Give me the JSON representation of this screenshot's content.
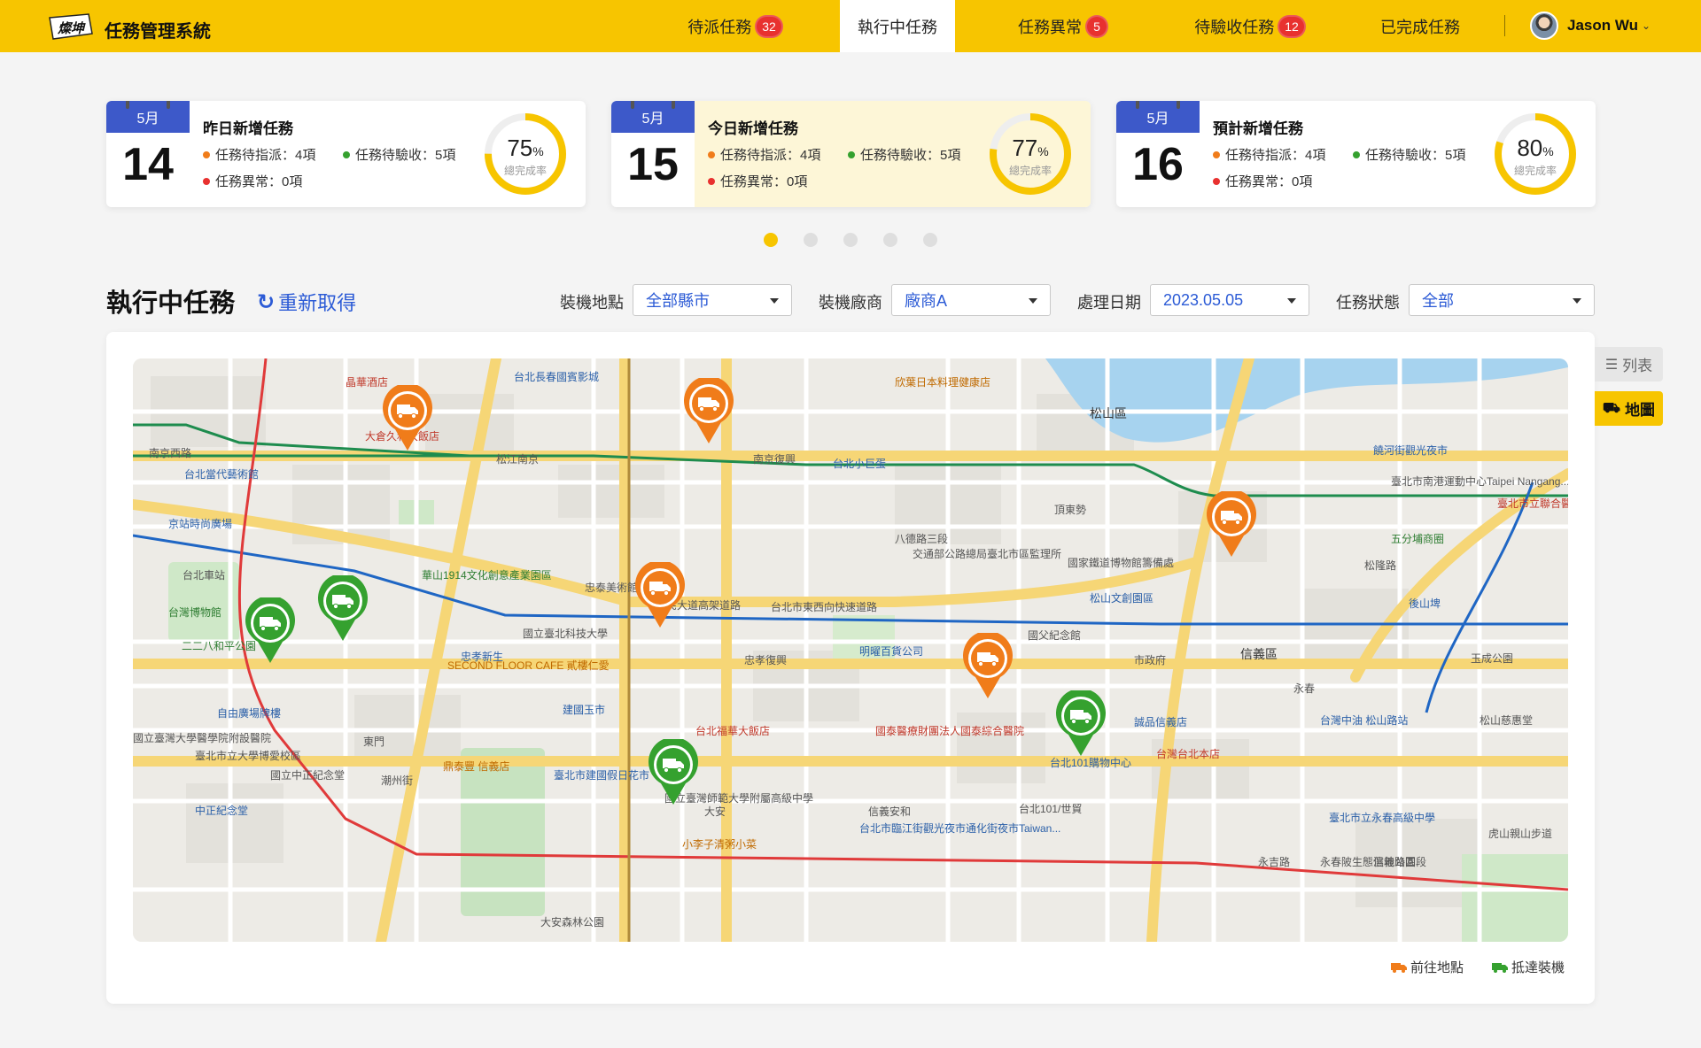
{
  "app": {
    "logo_text": "燦坤",
    "title": "任務管理系統"
  },
  "nav": {
    "items": [
      {
        "label": "待派任務",
        "badge": "32"
      },
      {
        "label": "執行中任務",
        "badge": ""
      },
      {
        "label": "任務異常",
        "badge": "5"
      },
      {
        "label": "待驗收任務",
        "badge": "12"
      },
      {
        "label": "已完成任務",
        "badge": ""
      }
    ],
    "active": "執行中任務"
  },
  "user": {
    "name": "Jason Wu"
  },
  "cards": [
    {
      "month": "5月",
      "day": "14",
      "title": "昨日新增任務",
      "pending_assign": "任務待指派：4項",
      "pending_accept": "任務待驗收：5項",
      "abnormal": "任務異常：0項",
      "rate": 75,
      "rate_text": "75",
      "rate_unit": "%",
      "rate_label": "總完成率",
      "highlight": false
    },
    {
      "month": "5月",
      "day": "15",
      "title": "今日新增任務",
      "pending_assign": "任務待指派：4項",
      "pending_accept": "任務待驗收：5項",
      "abnormal": "任務異常：0項",
      "rate": 77,
      "rate_text": "77",
      "rate_unit": "%",
      "rate_label": "總完成率",
      "highlight": true
    },
    {
      "month": "5月",
      "day": "16",
      "title": "預計新增任務",
      "pending_assign": "任務待指派：4項",
      "pending_accept": "任務待驗收：5項",
      "abnormal": "任務異常：0項",
      "rate": 80,
      "rate_text": "80",
      "rate_unit": "%",
      "rate_label": "總完成率",
      "highlight": false
    }
  ],
  "pager": {
    "count": 5,
    "active": 0
  },
  "section": {
    "title": "執行中任務",
    "refresh_label": "重新取得"
  },
  "filters": {
    "location": {
      "label": "裝機地點",
      "value": "全部縣市"
    },
    "vendor": {
      "label": "裝機廠商",
      "value": "廠商A"
    },
    "date": {
      "label": "處理日期",
      "value": "2023.05.05"
    },
    "status": {
      "label": "任務狀態",
      "value": "全部"
    }
  },
  "view_toggle": {
    "list_label": "列表",
    "map_label": "地圖",
    "active": "map"
  },
  "legend": {
    "heading_label": "前往地點",
    "arrived_label": "抵達裝機"
  },
  "colors": {
    "brand_yellow": "#f7c500",
    "badge_red": "#e8312f",
    "link_blue": "#2c5bd6",
    "calendar_blue": "#3d59c9",
    "heading_pin": "#f07c1a",
    "arrived_pin": "#35a12f",
    "dot_orange": "#f07c1a",
    "dot_green": "#35a12f",
    "dot_red": "#e8312f"
  },
  "map": {
    "pins": [
      {
        "status": "heading",
        "icon": "truck-icon"
      },
      {
        "status": "heading",
        "icon": "truck-icon"
      },
      {
        "status": "heading",
        "icon": "truck-icon"
      },
      {
        "status": "heading",
        "icon": "truck-icon"
      },
      {
        "status": "heading",
        "icon": "truck-icon"
      },
      {
        "status": "arrived",
        "icon": "truck-icon"
      },
      {
        "status": "arrived",
        "icon": "truck-icon"
      },
      {
        "status": "arrived",
        "icon": "truck-icon"
      },
      {
        "status": "arrived",
        "icon": "truck-icon"
      }
    ],
    "labels": [
      "晶華酒店",
      "大倉久和大飯店",
      "南京西路",
      "松江南京",
      "南京復興",
      "台北小巨蛋",
      "松山區",
      "台北當代藝術館",
      "京站時尚廣場",
      "台北車站",
      "華山1914文化創意產業園區",
      "忠孝新生",
      "國立臺北科技大學",
      "市民大道高架道路",
      "台北市東西向快速道路",
      "忠孝復興",
      "明曜百貨公司",
      "國父紀念館",
      "市政府",
      "信義區",
      "台北101購物中心",
      "台北101/世貿",
      "大安森林公園",
      "大安",
      "信義安和",
      "國立臺灣師範大學附屬高級中學",
      "中正紀念堂",
      "國立中正紀念堂",
      "東門",
      "台北福華大飯店",
      "建國玉市",
      "臺北市建國假日花市",
      "台北市臨江街觀光夜市通化街夜市Taiwan...",
      "國泰醫療財團法人國泰綜合醫院",
      "誠品信義店",
      "台灣台北本店",
      "永春",
      "後山埤",
      "五分埔商圈",
      "玉成公園",
      "台灣中油 松山路站",
      "松山慈惠堂",
      "臺北市立永春高級中學",
      "永春陂生態濕地公園",
      "虎山親山步道",
      "饒河街觀光夜市",
      "臺北市南港運動中心Taipei Nangang...",
      "臺北市立聯合醫院忠孝院區",
      "頂東勢",
      "八德路三段",
      "交通部公路總局臺北市區監理所",
      "國家鐵道博物館籌備處",
      "松山文創園區",
      "台北長春國賓影城",
      "忠泰美術館",
      "台灣博物館",
      "二二八和平公園",
      "自由廣場牌樓",
      "國立臺灣大學醫學院附設醫院",
      "臺北市立大學博愛校區",
      "SECOND FLOOR CAFE 貳樓仁愛",
      "鼎泰豐 信義店",
      "小李子清粥小菜",
      "欣葉日本料理健康店",
      "潮州街",
      "永吉路",
      "松隆路",
      "信義路四段"
    ]
  }
}
